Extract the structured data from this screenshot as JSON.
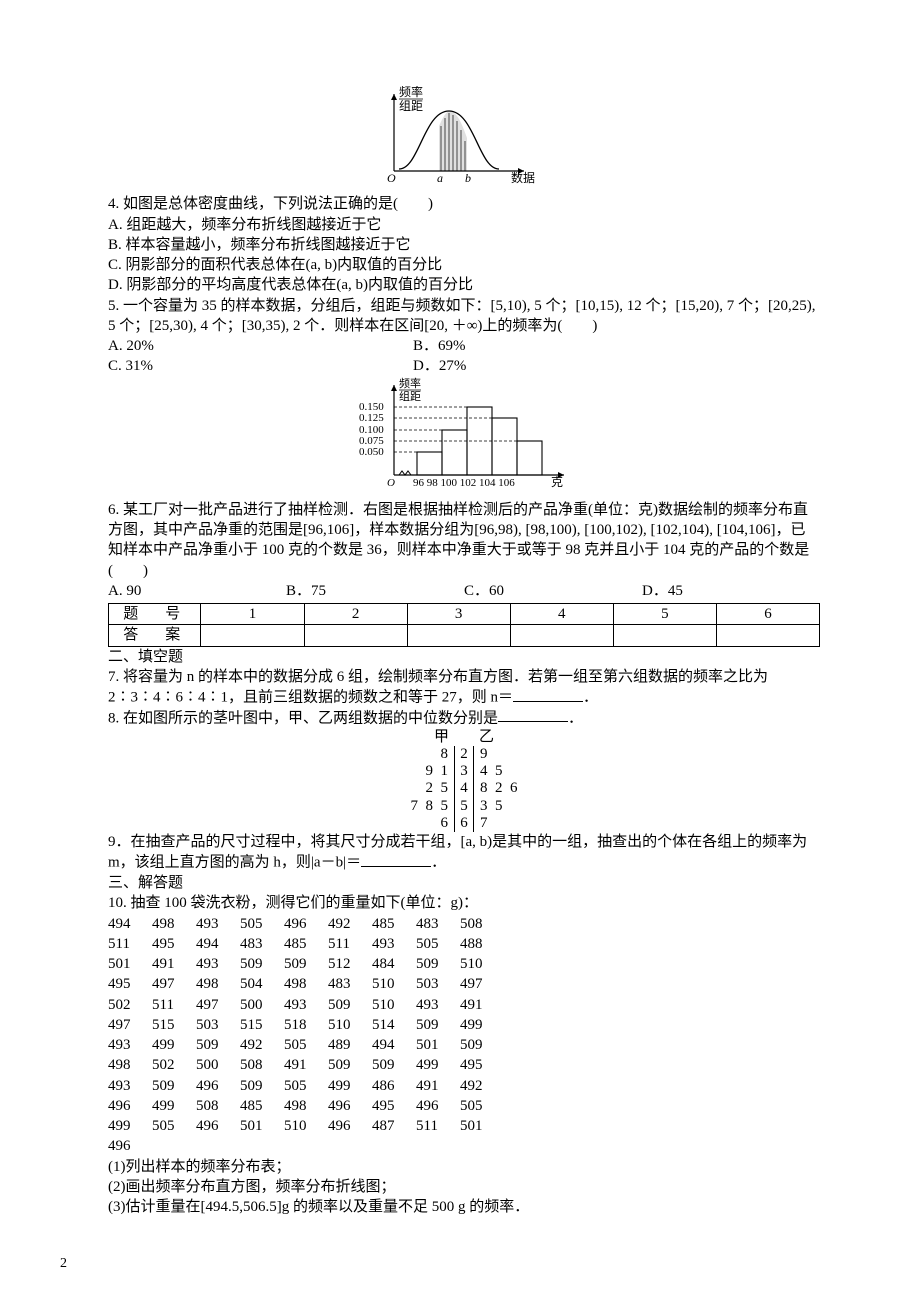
{
  "fig4": {
    "ylabel_top": "频率",
    "ylabel_bot": "组距",
    "origin": "O",
    "a": "a",
    "b": "b",
    "xlabel": "数据"
  },
  "q4": {
    "stem": "4. 如图是总体密度曲线，下列说法正确的是(　　)",
    "optA": "A. 组距越大，频率分布折线图越接近于它",
    "optB": "B. 样本容量越小，频率分布折线图越接近于它",
    "optC": "C. 阴影部分的面积代表总体在(a, b)内取值的百分比",
    "optD": "D. 阴影部分的平均高度代表总体在(a, b)内取值的百分比"
  },
  "q5": {
    "stem": "5. 一个容量为 35 的样本数据，分组后，组距与频数如下：[5,10), 5 个；[10,15), 12 个；[15,20), 7 个；[20,25), 5 个；[25,30), 4 个；[30,35), 2 个．则样本在区间[20, ＋∞)上的频率为(　　)",
    "optA": "A. 20%",
    "optB": "B．69%",
    "optC": "C. 31%",
    "optD": "D．27%"
  },
  "fig6": {
    "ylabel_top": "频率",
    "ylabel_bot": "组距",
    "yticks": [
      "0.150",
      "0.125",
      "0.100",
      "0.075",
      "0.050"
    ],
    "origin": "O",
    "xticks": "96 98 100 102 104 106",
    "xlabel": "克"
  },
  "q6": {
    "stem": "6. 某工厂对一批产品进行了抽样检测．右图是根据抽样检测后的产品净重(单位：克)数据绘制的频率分布直方图，其中产品净重的范围是[96,106]，样本数据分组为[96,98), [98,100), [100,102), [102,104), [104,106]，已知样本中产品净重小于 100 克的个数是 36，则样本中净重大于或等于 98 克并且小于 104 克的产品的个数是(　　)",
    "optA": "A. 90",
    "optB": "B．75",
    "optC": "C．60",
    "optD": "D．45"
  },
  "answer_table": {
    "row1h": "题　号",
    "row2h": "答　案",
    "cols": [
      "1",
      "2",
      "3",
      "4",
      "5",
      "6"
    ]
  },
  "sec2": {
    "title": "二、填空题"
  },
  "q7": {
    "line1": "7. 将容量为 n 的样本中的数据分成 6 组，绘制频率分布直方图．若第一组至第六组数据的频率之比为",
    "line2_pre": "2∶3∶4∶6∶4∶1，且前三组数据的频数之和等于 27，则 n＝",
    "line2_post": "．"
  },
  "q8": {
    "stem_pre": "8. 在如图所示的茎叶图中，甲、乙两组数据的中位数分别是",
    "stem_post": "．",
    "header_l": "甲",
    "header_r": "乙",
    "rows": [
      {
        "l": "8",
        "c": "2",
        "r": "9"
      },
      {
        "l": "9  1",
        "c": "3",
        "r": "4  5"
      },
      {
        "l": "2  5",
        "c": "4",
        "r": "8  2  6"
      },
      {
        "l": "7  8  5",
        "c": "5",
        "r": "3  5"
      },
      {
        "l": "6",
        "c": "6",
        "r": "7"
      }
    ]
  },
  "q9": {
    "stem_pre": "9．在抽查产品的尺寸过程中，将其尺寸分成若干组，[a, b)是其中的一组，抽查出的个体在各组上的频率为 m，该组上直方图的高为 h，则|a－b|＝",
    "stem_post": "．"
  },
  "sec3": {
    "title": "三、解答题"
  },
  "q10": {
    "stem": "10. 抽查 100 袋洗衣粉，测得它们的重量如下(单位：g)：",
    "data": [
      [
        "494",
        "498",
        "493",
        "505",
        "496",
        "492",
        "485",
        "483",
        "508"
      ],
      [
        "511",
        "495",
        "494",
        "483",
        "485",
        "511",
        "493",
        "505",
        "488"
      ],
      [
        "501",
        "491",
        "493",
        "509",
        "509",
        "512",
        "484",
        "509",
        "510"
      ],
      [
        "495",
        "497",
        "498",
        "504",
        "498",
        "483",
        "510",
        "503",
        "497"
      ],
      [
        "502",
        "511",
        "497",
        "500",
        "493",
        "509",
        "510",
        "493",
        "491"
      ],
      [
        "497",
        "515",
        "503",
        "515",
        "518",
        "510",
        "514",
        "509",
        "499"
      ],
      [
        "493",
        "499",
        "509",
        "492",
        "505",
        "489",
        "494",
        "501",
        "509"
      ],
      [
        "498",
        "502",
        "500",
        "508",
        "491",
        "509",
        "509",
        "499",
        "495"
      ],
      [
        "493",
        "509",
        "496",
        "509",
        "505",
        "499",
        "486",
        "491",
        "492"
      ],
      [
        "496",
        "499",
        "508",
        "485",
        "498",
        "496",
        "495",
        "496",
        "505"
      ],
      [
        "499",
        "505",
        "496",
        "501",
        "510",
        "496",
        "487",
        "511",
        "501"
      ],
      [
        "496"
      ]
    ],
    "p1": "(1)列出样本的频率分布表；",
    "p2": "(2)画出频率分布直方图，频率分布折线图；",
    "p3": "(3)估计重量在[494.5,506.5]g 的频率以及重量不足 500 g 的频率．"
  },
  "page_num": "2",
  "chart_data": [
    {
      "type": "area",
      "title": "总体密度曲线",
      "xlabel": "数据",
      "ylabel": "频率/组距",
      "x": [
        "O",
        "a",
        "b"
      ],
      "note": "bell-shaped density curve; shaded region between a and b"
    },
    {
      "type": "bar",
      "title": "产品净重频率分布直方图",
      "xlabel": "克",
      "ylabel": "频率/组距",
      "categories": [
        "[96,98)",
        "[98,100)",
        "[100,102)",
        "[102,104)",
        "[104,106]"
      ],
      "values": [
        0.05,
        0.1,
        0.15,
        0.125,
        0.075
      ],
      "ylim": [
        0,
        0.15
      ]
    }
  ]
}
